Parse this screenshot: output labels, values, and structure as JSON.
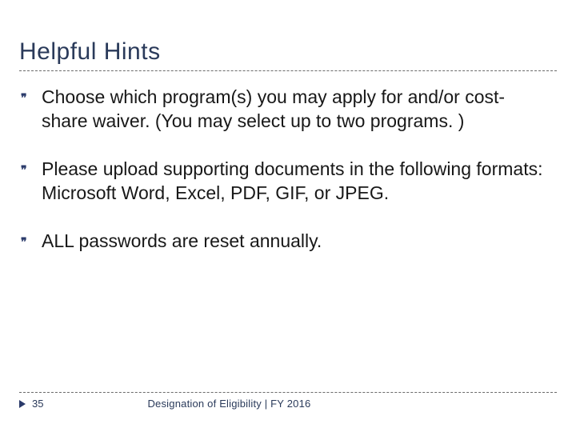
{
  "title": "Helpful Hints",
  "bullets": [
    "Choose which program(s) you may apply for and/or cost-share waiver.  (You may select up to two programs. )",
    "Please upload supporting documents in the following formats:   Microsoft Word, Excel, PDF, GIF, or JPEG.",
    "ALL passwords are reset annually."
  ],
  "footer": {
    "page": "35",
    "caption": "Designation of Eligibility | FY 2016"
  },
  "bullet_glyph": "❞"
}
